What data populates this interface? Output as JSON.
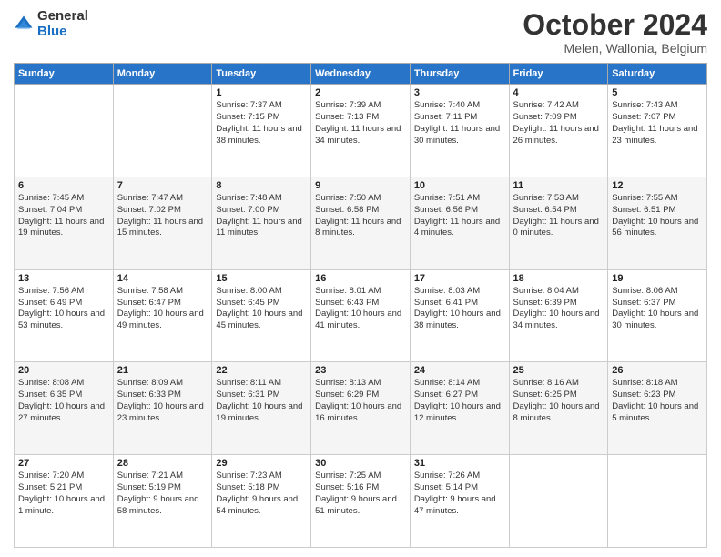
{
  "header": {
    "logo": {
      "general": "General",
      "blue": "Blue"
    },
    "title": "October 2024",
    "location": "Melen, Wallonia, Belgium"
  },
  "weekdays": [
    "Sunday",
    "Monday",
    "Tuesday",
    "Wednesday",
    "Thursday",
    "Friday",
    "Saturday"
  ],
  "weeks": [
    [
      {
        "day": "",
        "info": ""
      },
      {
        "day": "",
        "info": ""
      },
      {
        "day": "1",
        "info": "Sunrise: 7:37 AM\nSunset: 7:15 PM\nDaylight: 11 hours and 38 minutes."
      },
      {
        "day": "2",
        "info": "Sunrise: 7:39 AM\nSunset: 7:13 PM\nDaylight: 11 hours and 34 minutes."
      },
      {
        "day": "3",
        "info": "Sunrise: 7:40 AM\nSunset: 7:11 PM\nDaylight: 11 hours and 30 minutes."
      },
      {
        "day": "4",
        "info": "Sunrise: 7:42 AM\nSunset: 7:09 PM\nDaylight: 11 hours and 26 minutes."
      },
      {
        "day": "5",
        "info": "Sunrise: 7:43 AM\nSunset: 7:07 PM\nDaylight: 11 hours and 23 minutes."
      }
    ],
    [
      {
        "day": "6",
        "info": "Sunrise: 7:45 AM\nSunset: 7:04 PM\nDaylight: 11 hours and 19 minutes."
      },
      {
        "day": "7",
        "info": "Sunrise: 7:47 AM\nSunset: 7:02 PM\nDaylight: 11 hours and 15 minutes."
      },
      {
        "day": "8",
        "info": "Sunrise: 7:48 AM\nSunset: 7:00 PM\nDaylight: 11 hours and 11 minutes."
      },
      {
        "day": "9",
        "info": "Sunrise: 7:50 AM\nSunset: 6:58 PM\nDaylight: 11 hours and 8 minutes."
      },
      {
        "day": "10",
        "info": "Sunrise: 7:51 AM\nSunset: 6:56 PM\nDaylight: 11 hours and 4 minutes."
      },
      {
        "day": "11",
        "info": "Sunrise: 7:53 AM\nSunset: 6:54 PM\nDaylight: 11 hours and 0 minutes."
      },
      {
        "day": "12",
        "info": "Sunrise: 7:55 AM\nSunset: 6:51 PM\nDaylight: 10 hours and 56 minutes."
      }
    ],
    [
      {
        "day": "13",
        "info": "Sunrise: 7:56 AM\nSunset: 6:49 PM\nDaylight: 10 hours and 53 minutes."
      },
      {
        "day": "14",
        "info": "Sunrise: 7:58 AM\nSunset: 6:47 PM\nDaylight: 10 hours and 49 minutes."
      },
      {
        "day": "15",
        "info": "Sunrise: 8:00 AM\nSunset: 6:45 PM\nDaylight: 10 hours and 45 minutes."
      },
      {
        "day": "16",
        "info": "Sunrise: 8:01 AM\nSunset: 6:43 PM\nDaylight: 10 hours and 41 minutes."
      },
      {
        "day": "17",
        "info": "Sunrise: 8:03 AM\nSunset: 6:41 PM\nDaylight: 10 hours and 38 minutes."
      },
      {
        "day": "18",
        "info": "Sunrise: 8:04 AM\nSunset: 6:39 PM\nDaylight: 10 hours and 34 minutes."
      },
      {
        "day": "19",
        "info": "Sunrise: 8:06 AM\nSunset: 6:37 PM\nDaylight: 10 hours and 30 minutes."
      }
    ],
    [
      {
        "day": "20",
        "info": "Sunrise: 8:08 AM\nSunset: 6:35 PM\nDaylight: 10 hours and 27 minutes."
      },
      {
        "day": "21",
        "info": "Sunrise: 8:09 AM\nSunset: 6:33 PM\nDaylight: 10 hours and 23 minutes."
      },
      {
        "day": "22",
        "info": "Sunrise: 8:11 AM\nSunset: 6:31 PM\nDaylight: 10 hours and 19 minutes."
      },
      {
        "day": "23",
        "info": "Sunrise: 8:13 AM\nSunset: 6:29 PM\nDaylight: 10 hours and 16 minutes."
      },
      {
        "day": "24",
        "info": "Sunrise: 8:14 AM\nSunset: 6:27 PM\nDaylight: 10 hours and 12 minutes."
      },
      {
        "day": "25",
        "info": "Sunrise: 8:16 AM\nSunset: 6:25 PM\nDaylight: 10 hours and 8 minutes."
      },
      {
        "day": "26",
        "info": "Sunrise: 8:18 AM\nSunset: 6:23 PM\nDaylight: 10 hours and 5 minutes."
      }
    ],
    [
      {
        "day": "27",
        "info": "Sunrise: 7:20 AM\nSunset: 5:21 PM\nDaylight: 10 hours and 1 minute."
      },
      {
        "day": "28",
        "info": "Sunrise: 7:21 AM\nSunset: 5:19 PM\nDaylight: 9 hours and 58 minutes."
      },
      {
        "day": "29",
        "info": "Sunrise: 7:23 AM\nSunset: 5:18 PM\nDaylight: 9 hours and 54 minutes."
      },
      {
        "day": "30",
        "info": "Sunrise: 7:25 AM\nSunset: 5:16 PM\nDaylight: 9 hours and 51 minutes."
      },
      {
        "day": "31",
        "info": "Sunrise: 7:26 AM\nSunset: 5:14 PM\nDaylight: 9 hours and 47 minutes."
      },
      {
        "day": "",
        "info": ""
      },
      {
        "day": "",
        "info": ""
      }
    ]
  ]
}
